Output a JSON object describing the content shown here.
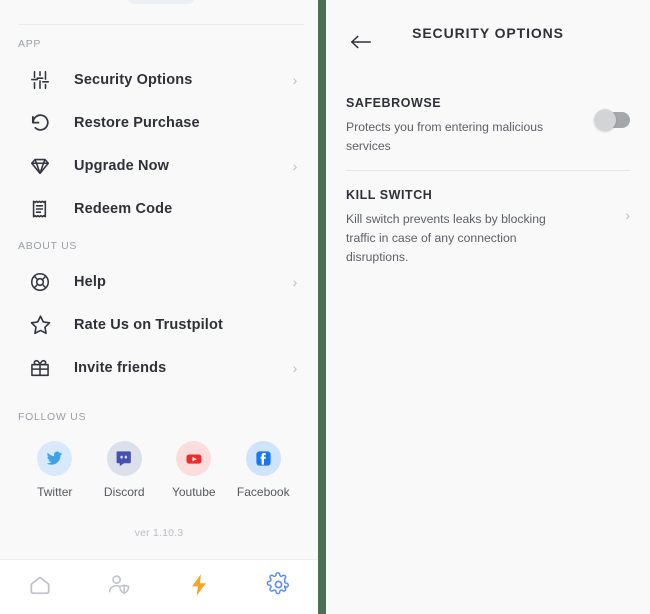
{
  "left": {
    "sections": [
      {
        "label": "APP",
        "items": [
          {
            "icon": "sliders-icon",
            "label": "Security Options",
            "chevron": true
          },
          {
            "icon": "restore-arrow-icon",
            "label": "Restore Purchase",
            "chevron": false
          },
          {
            "icon": "diamond-icon",
            "label": "Upgrade Now",
            "chevron": true
          },
          {
            "icon": "receipt-icon",
            "label": "Redeem Code",
            "chevron": false
          }
        ]
      },
      {
        "label": "ABOUT US",
        "items": [
          {
            "icon": "lifebuoy-icon",
            "label": "Help",
            "chevron": true
          },
          {
            "icon": "star-icon",
            "label": "Rate Us on Trustpilot",
            "chevron": false
          },
          {
            "icon": "gift-icon",
            "label": "Invite friends",
            "chevron": true
          }
        ]
      }
    ],
    "follow_label": "FOLLOW US",
    "socials": [
      {
        "icon": "twitter-icon",
        "name": "Twitter",
        "bg": "#D7E9FB",
        "fg": "#3FA2E8"
      },
      {
        "icon": "discord-icon",
        "name": "Discord",
        "bg": "#DCE0EA",
        "fg": "#4650B0"
      },
      {
        "icon": "youtube-icon",
        "name": "Youtube",
        "bg": "#FBDDDD",
        "fg": "#EE2B2B"
      },
      {
        "icon": "facebook-icon",
        "name": "Facebook",
        "bg": "#CFE3FA",
        "fg": "#1977F2"
      }
    ],
    "version": "ver 1.10.3",
    "nav": [
      {
        "icon": "home-icon",
        "name": "home",
        "color": "#BFC3C9",
        "active": false
      },
      {
        "icon": "account-shield-icon",
        "name": "account",
        "color": "#BFC3C9",
        "active": false
      },
      {
        "icon": "lightning-icon",
        "name": "connect",
        "color": "#F5A623",
        "active": false
      },
      {
        "icon": "gear-icon",
        "name": "settings",
        "color": "#5B8DEF",
        "active": true
      }
    ]
  },
  "right": {
    "back_icon": "back-arrow-icon",
    "title": "SECURITY OPTIONS",
    "options": [
      {
        "title": "SAFEBROWSE",
        "desc": "Protects you from entering malicious services",
        "control": "toggle",
        "toggle_on": false
      },
      {
        "title": "KILL SWITCH",
        "desc": "Kill switch prevents leaks by blocking traffic in case of any connection disruptions.",
        "control": "chevron",
        "chevron_glyph": "›"
      }
    ]
  },
  "glyphs": {
    "chevron": "›"
  },
  "colors": {
    "divider_green": "#4B7053",
    "panel_bg": "#F9F9FA",
    "accent_blue": "#5B8DEF",
    "accent_orange": "#F5A623"
  }
}
